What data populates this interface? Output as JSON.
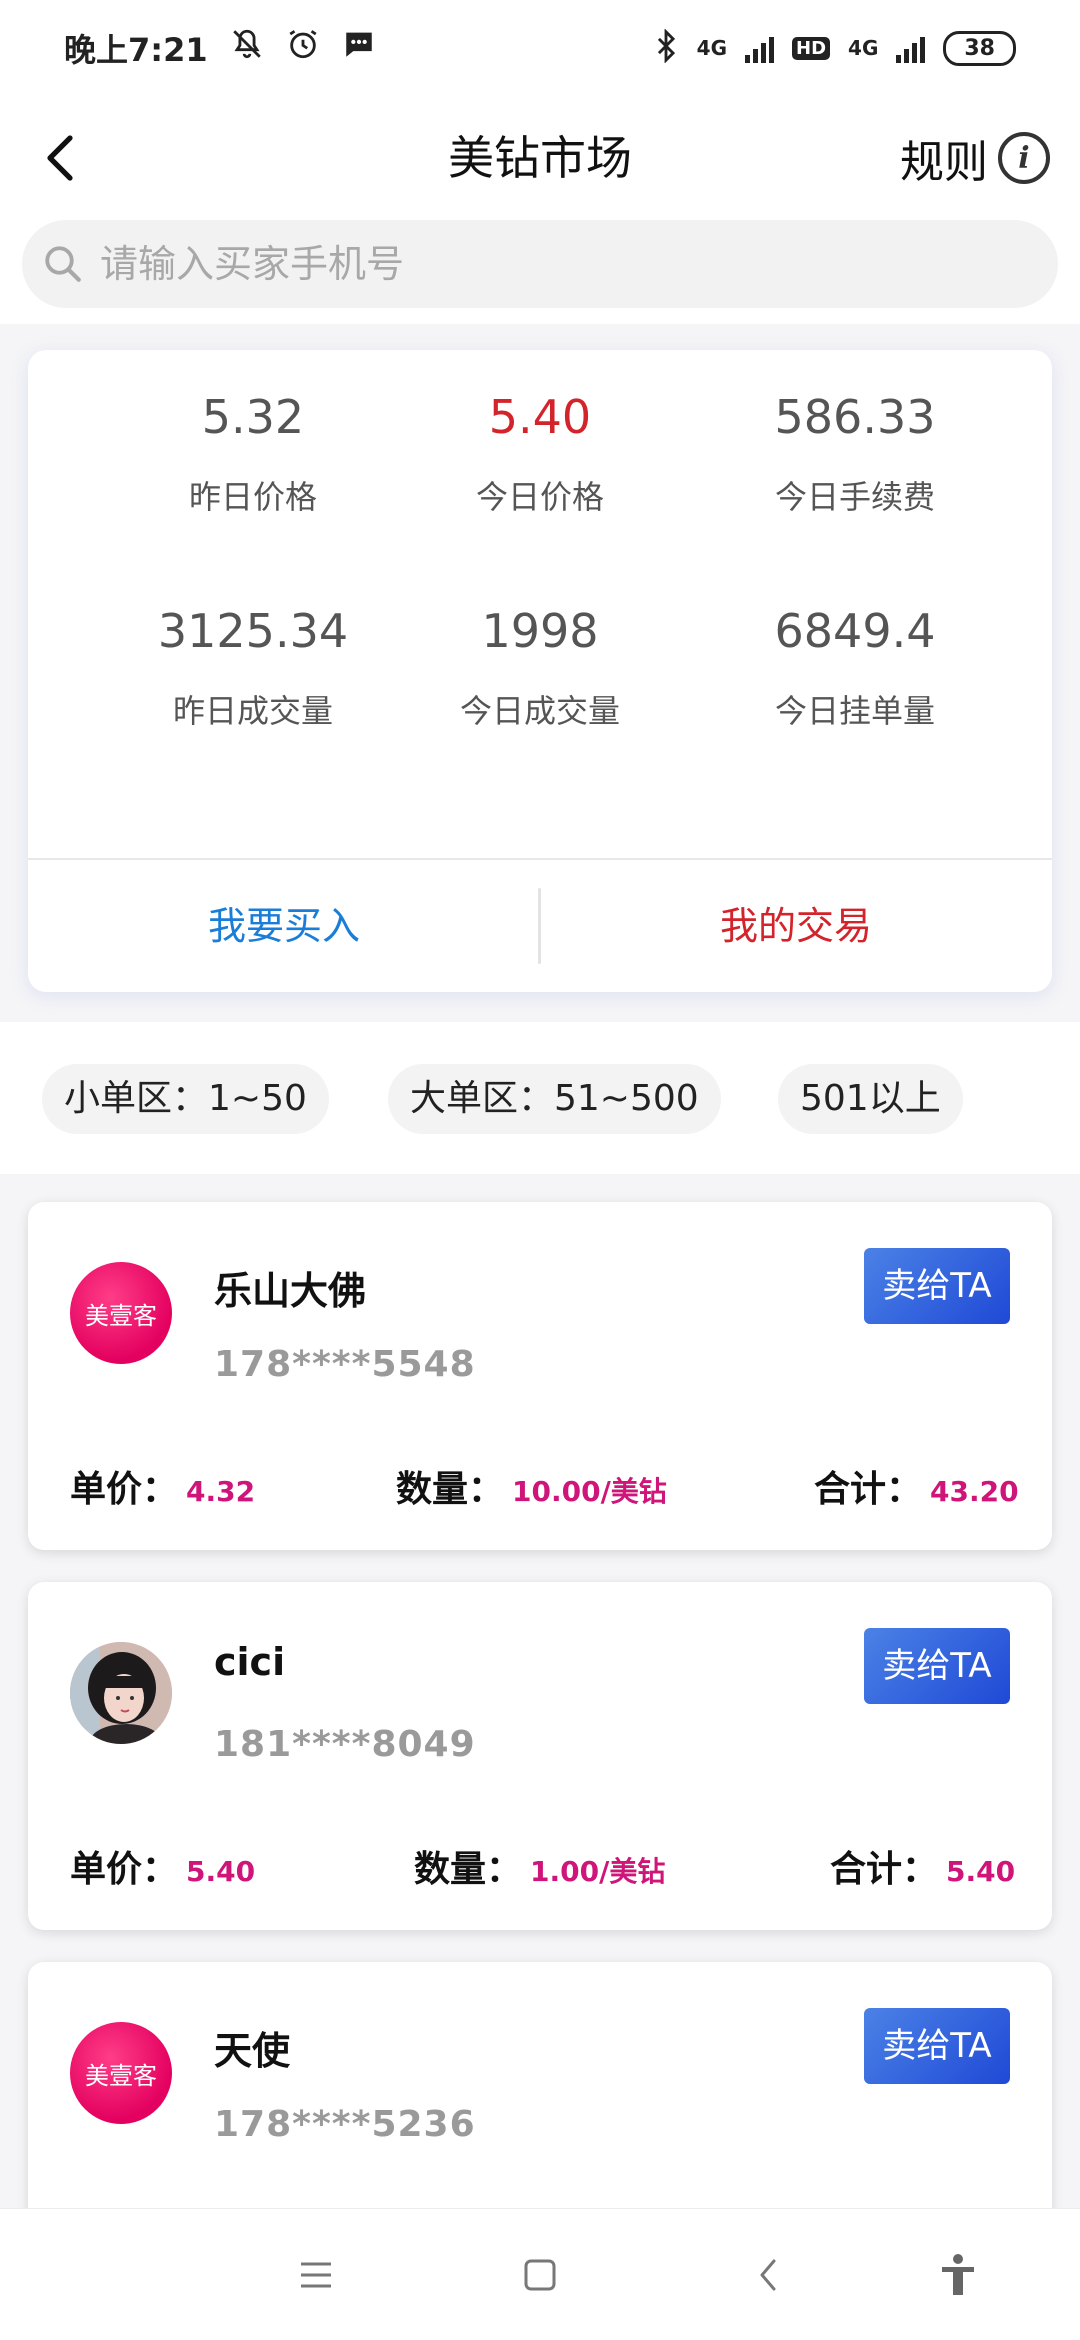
{
  "status_bar": {
    "time": "晚上7:21",
    "network_1": "4G",
    "network_2": "4G",
    "hd": "HD",
    "battery": "38",
    "icons": [
      "mute-icon",
      "alarm-icon",
      "message-icon",
      "bluetooth-icon",
      "signal-icon",
      "battery-icon"
    ]
  },
  "header": {
    "title": "美钻市场",
    "rules_label": "规则"
  },
  "search": {
    "placeholder": "请输入买家手机号"
  },
  "stats": [
    {
      "value": "5.32",
      "label": "昨日价格",
      "highlight": false
    },
    {
      "value": "5.40",
      "label": "今日价格",
      "highlight": true
    },
    {
      "value": "586.33",
      "label": "今日手续费",
      "highlight": false
    },
    {
      "value": "3125.34",
      "label": "昨日成交量",
      "highlight": false
    },
    {
      "value": "1998",
      "label": "今日成交量",
      "highlight": false
    },
    {
      "value": "6849.4",
      "label": "今日挂单量",
      "highlight": false
    }
  ],
  "actions": {
    "buy": "我要买入",
    "my_trades": "我的交易"
  },
  "zones": [
    {
      "label": "小单区：1~50"
    },
    {
      "label": "大单区：51~500"
    },
    {
      "label": "501以上"
    }
  ],
  "orders": [
    {
      "avatar_text": "美壹客",
      "name": "乐山大佛",
      "phone": "178****5548",
      "sell_label": "卖给TA",
      "price_label": "单价：",
      "price": "4.32",
      "qty_label": "数量：",
      "qty": "10.00/美钻",
      "total_label": "合计：",
      "total": "43.20"
    },
    {
      "avatar_text": "",
      "name": "cici",
      "phone": "181****8049",
      "sell_label": "卖给TA",
      "price_label": "单价：",
      "price": "5.40",
      "qty_label": "数量：",
      "qty": "1.00/美钻",
      "total_label": "合计：",
      "total": "5.40"
    },
    {
      "avatar_text": "美壹客",
      "name": "天使",
      "phone": "178****5236",
      "sell_label": "卖给TA"
    }
  ],
  "colors": {
    "accent_blue": "#1a7ed8",
    "accent_red": "#d3232b",
    "value_pink": "#d0157a",
    "button_blue": "#2f5fe0"
  }
}
